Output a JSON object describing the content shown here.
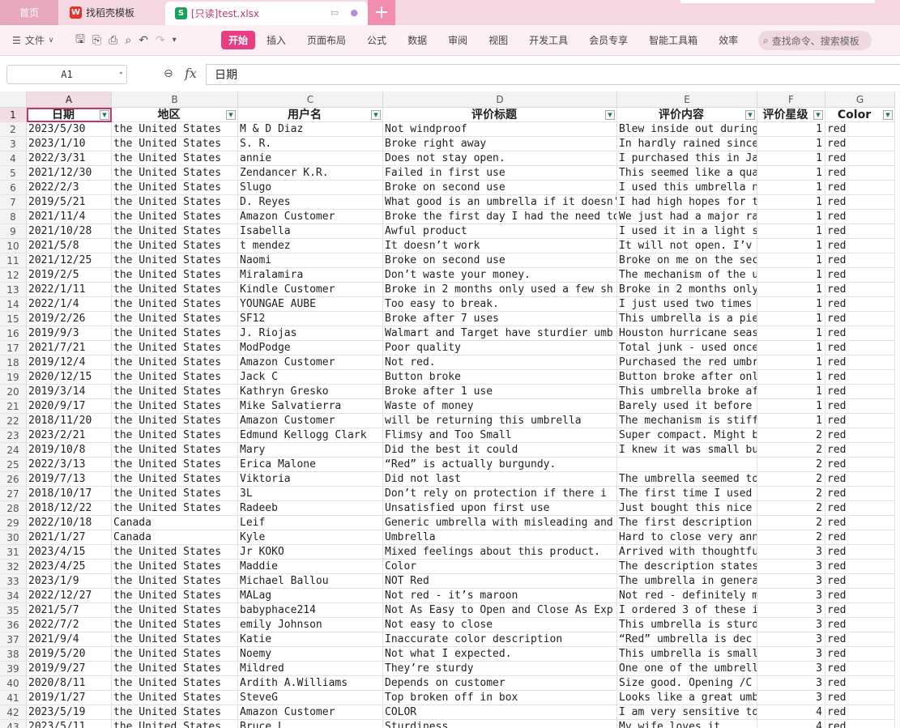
{
  "tabs": {
    "home": "首页",
    "template": "找稻壳模板",
    "file": "[只读]test.xlsx"
  },
  "toolbar": {
    "file_menu": "文件",
    "start": "开始",
    "menus": [
      "插入",
      "页面布局",
      "公式",
      "数据",
      "审阅",
      "视图",
      "开发工具",
      "会员专享",
      "智能工具箱",
      "效率"
    ],
    "search_placeholder": "查找命令、搜索模板"
  },
  "formula": {
    "cell_ref": "A1",
    "fx": "fx",
    "content": "日期"
  },
  "columns": [
    "A",
    "B",
    "C",
    "D",
    "E",
    "F",
    "G"
  ],
  "headers": [
    "日期",
    "地区",
    "用户名",
    "评价标题",
    "评价内容",
    "评价星级",
    "Color"
  ],
  "rows": [
    [
      "2023/5/30",
      "the United States",
      "M & D Diaz",
      "Not windproof",
      "Blew inside out during",
      "1",
      "red"
    ],
    [
      "2023/1/10",
      "the United States",
      "S. R.",
      "Broke right away",
      "In hardly rained since",
      "1",
      "red"
    ],
    [
      "2022/3/31",
      "the United States",
      "annie",
      "Does not stay open.",
      "I purchased this in Ja",
      "1",
      "red"
    ],
    [
      "2021/12/30",
      "the United States",
      "Zendancer   K.R.",
      "Failed in first use",
      "This seemed like a qua",
      "1",
      "red"
    ],
    [
      "2022/2/3",
      "the United States",
      "Slugo",
      "Broke on second use",
      "I used this umbrella n",
      "1",
      "red"
    ],
    [
      "2019/5/21",
      "the United States",
      "D. Reyes",
      "What good is an umbrella if it doesn't",
      "I had high hopes for t",
      "1",
      "red"
    ],
    [
      "2021/11/4",
      "the United States",
      "Amazon Customer",
      "Broke the first day I had the need to",
      "We just had a major ra",
      "1",
      "red"
    ],
    [
      "2021/10/28",
      "the United States",
      "Isabella",
      "Awful product",
      "I used it in a light s",
      "1",
      "red"
    ],
    [
      "2021/5/8",
      "the United States",
      "t mendez",
      "It doesn’t work",
      "It will not open. I’v",
      "1",
      "red"
    ],
    [
      "2021/12/25",
      "the United States",
      "Naomi",
      "Broke on second use",
      "Broke on me on the sec",
      "1",
      "red"
    ],
    [
      "2019/2/5",
      "the United States",
      "Miralamira",
      "Don’t waste your money.",
      "The mechanism of the u",
      "1",
      "red"
    ],
    [
      "2022/1/11",
      "the United States",
      "Kindle Customer",
      "Broke in 2 months only used a few sh",
      "Broke in 2 months only",
      "1",
      "red"
    ],
    [
      "2022/1/4",
      "the United States",
      "YOUNGAE AUBE",
      "Too easy to break.",
      "I just used two times",
      "1",
      "red"
    ],
    [
      "2019/2/26",
      "the United States",
      "SF12",
      "Broke after 7 uses",
      "This umbrella is a pie",
      "1",
      "red"
    ],
    [
      "2019/9/3",
      "the United States",
      "J. Riojas",
      "Walmart and Target have sturdier umb",
      "Houston hurricane seas",
      "1",
      "red"
    ],
    [
      "2021/7/21",
      "the United States",
      "ModPodge",
      "Poor quality",
      "Total junk - used once",
      "1",
      "red"
    ],
    [
      "2019/12/4",
      "the United States",
      "Amazon Customer",
      "Not red.",
      "Purchased the red umbr",
      "1",
      "red"
    ],
    [
      "2020/12/15",
      "the United States",
      "Jack C",
      "Button broke",
      "Button broke after onl",
      "1",
      "red"
    ],
    [
      "2019/3/14",
      "the United States",
      "Kathryn Gresko",
      "Broke after 1 use",
      "This umbrella broke af",
      "1",
      "red"
    ],
    [
      "2020/9/17",
      "the United States",
      "Mike Salvatierra",
      "Waste of money",
      "Barely used it before",
      "1",
      "red"
    ],
    [
      "2018/11/20",
      "the United States",
      "Amazon Customer",
      "will be returning this umbrella",
      "The mechanism is stiff",
      "1",
      "red"
    ],
    [
      "2023/2/21",
      "the United States",
      "Edmund Kellogg Clark",
      "Flimsy and Too Small",
      "Super compact. Might b",
      "2",
      "red"
    ],
    [
      "2019/10/8",
      "the United States",
      "Mary",
      "Did the best it could",
      "I knew it was small bu",
      "2",
      "red"
    ],
    [
      "2022/3/13",
      "the United States",
      "Erica Malone",
      "“Red” is actually burgundy.",
      "",
      "2",
      "red"
    ],
    [
      "2019/7/13",
      "the United States",
      "Viktoria",
      "Did not last",
      "The umbrella seemed to",
      "2",
      "red"
    ],
    [
      "2018/10/17",
      "the United States",
      "3L",
      "Don’t rely on protection if there i",
      "The first time I used",
      "2",
      "red"
    ],
    [
      "2018/12/22",
      "the United States",
      "Radeeb",
      "Unsatisfied upon first use",
      "Just bought this nice",
      "2",
      "red"
    ],
    [
      "2022/10/18",
      "Canada",
      "Leif",
      "Generic umbrella with misleading and",
      "The first description",
      "2",
      "red"
    ],
    [
      "2021/1/27",
      "Canada",
      "Kyle",
      "Umbrella",
      "Hard to close very ann",
      "2",
      "red"
    ],
    [
      "2023/4/15",
      "the United States",
      "Jr KOKO",
      "Mixed feelings about this product.",
      "Arrived with thoughtfu",
      "3",
      "red"
    ],
    [
      "2023/4/25",
      "the United States",
      "Maddie",
      "Color",
      "The description states",
      "3",
      "red"
    ],
    [
      "2023/1/9",
      "the United States",
      "Michael Ballou",
      "NOT Red",
      "The umbrella in genera",
      "3",
      "red"
    ],
    [
      "2022/12/27",
      "the United States",
      "MALag",
      "Not red - it’s maroon",
      "Not red - definitely m",
      "3",
      "red"
    ],
    [
      "2021/5/7",
      "the United States",
      "babyphace214",
      "Not As Easy to Open and Close As Exp",
      "I ordered 3 of these i",
      "3",
      "red"
    ],
    [
      "2022/7/2",
      "the United States",
      "emily Johnson",
      "Not easy to close",
      "This umbrella is sturd",
      "3",
      "red"
    ],
    [
      "2021/9/4",
      "the United States",
      "Katie",
      "Inaccurate color description",
      "“Red” umbrella is dec",
      "3",
      "red"
    ],
    [
      "2019/5/20",
      "the United States",
      "Noemy",
      "Not what I expected.",
      "This umbrella is small",
      "3",
      "red"
    ],
    [
      "2019/9/27",
      "the United States",
      "Mildred",
      "They’re sturdy",
      "One one of the umbrell",
      "3",
      "red"
    ],
    [
      "2020/8/11",
      "the United States",
      "Ardith A.Williams",
      "Depends on customer",
      "Size good.  Opening /C",
      "3",
      "red"
    ],
    [
      "2019/1/27",
      "the United States",
      "SteveG",
      "Top broken off in box",
      "Looks like a great umb",
      "3",
      "red"
    ],
    [
      "2023/5/19",
      "the United States",
      "Amazon Customer",
      "COLOR",
      "I am very sensitive to",
      "4",
      "red"
    ],
    [
      "2023/5/11",
      "the United States",
      "Bruce L",
      "Sturdiness",
      "My wife loves it",
      "4",
      "red"
    ]
  ]
}
